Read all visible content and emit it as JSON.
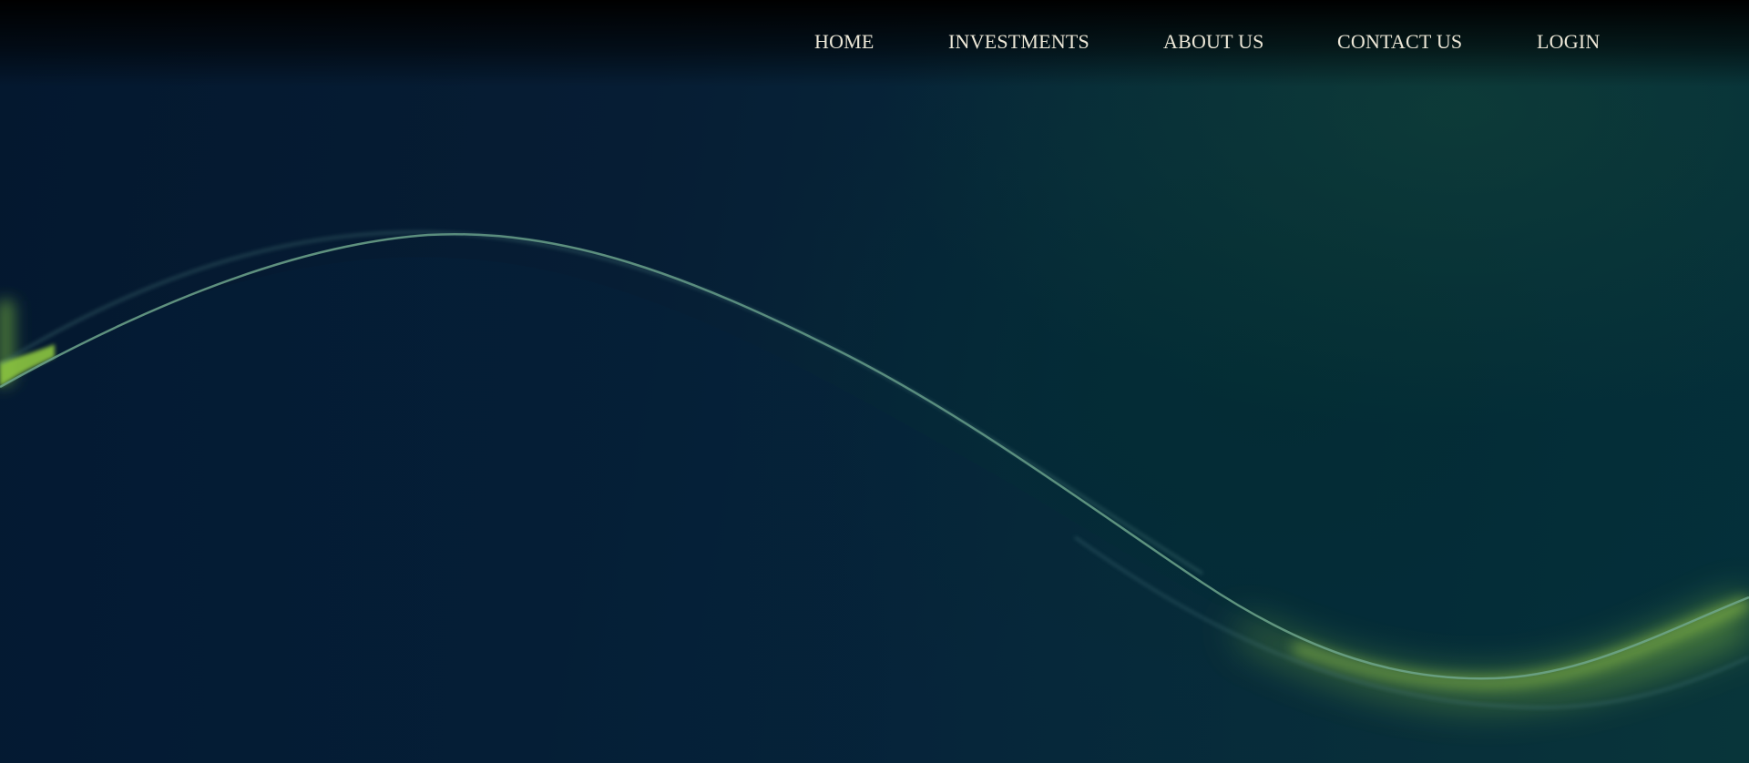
{
  "nav": {
    "items": [
      {
        "label": "HOME"
      },
      {
        "label": "INVESTMENTS"
      },
      {
        "label": "ABOUT US"
      },
      {
        "label": "CONTACT US"
      },
      {
        "label": "LOGIN"
      }
    ],
    "text_color": "#ece7d7"
  },
  "hero": {
    "background_colors": [
      "#04182f",
      "#06283a",
      "#04303a"
    ],
    "wave_accent_color": "#8cc63f",
    "wave_line_color": "#6fa68c"
  }
}
